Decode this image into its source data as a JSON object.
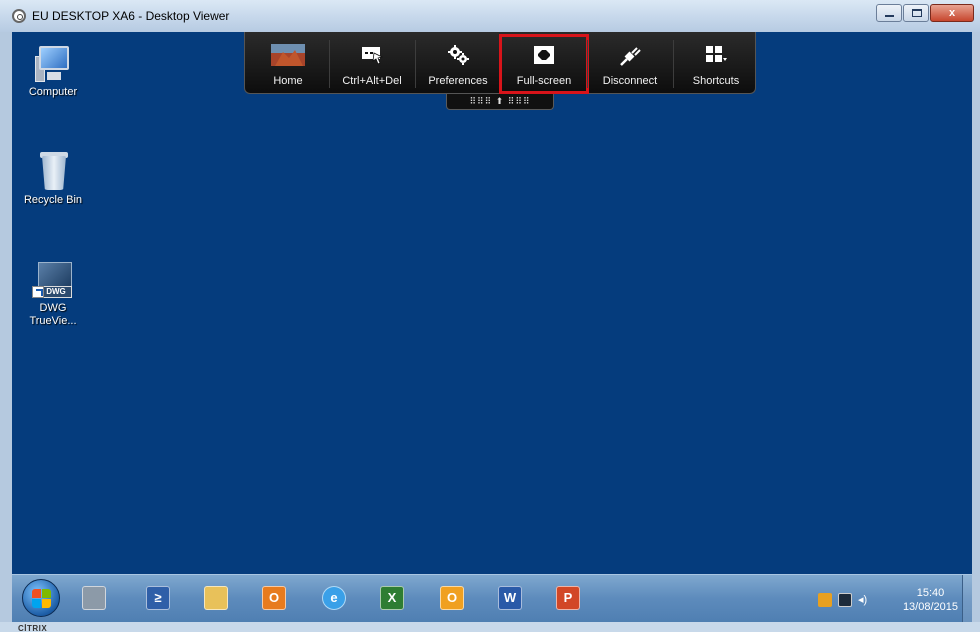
{
  "window": {
    "title": "EU DESKTOP XA6 - Desktop Viewer",
    "buttons": {
      "minimize": "",
      "maximize": "",
      "close": "x"
    }
  },
  "desktop": {
    "background_color": "#053c7d",
    "icons": [
      {
        "label": "Computer",
        "icon": "computer-icon"
      },
      {
        "label": "Recycle Bin",
        "icon": "recycle-bin-icon"
      },
      {
        "label": "DWG TrueVie...",
        "icon": "dwg-trueview-icon",
        "badge": "DWG"
      }
    ]
  },
  "toolbar": {
    "items": [
      {
        "label": "Home",
        "icon": "home-icon"
      },
      {
        "label": "Ctrl+Alt+Del",
        "icon": "ctrl-alt-del-icon"
      },
      {
        "label": "Preferences",
        "icon": "gears-icon"
      },
      {
        "label": "Full-screen",
        "icon": "fullscreen-icon",
        "highlighted": true
      },
      {
        "label": "Disconnect",
        "icon": "plug-icon"
      },
      {
        "label": "Shortcuts",
        "icon": "shortcuts-grid-icon"
      }
    ],
    "highlight_color": "#d8141a",
    "handle_text": "⠿⠿⠿ ⬆ ⠿⠿⠿"
  },
  "taskbar": {
    "apps": [
      {
        "name": "network-app-icon",
        "color": "#8c9aa8"
      },
      {
        "name": "powershell-icon",
        "color": "#2f5fa8",
        "glyph": "≥"
      },
      {
        "name": "file-explorer-icon",
        "color": "#e8c15a"
      },
      {
        "name": "outlook-icon",
        "color": "#e77b1e",
        "glyph": "O"
      },
      {
        "name": "internet-explorer-icon",
        "color": "#3aa0e8",
        "glyph": "e"
      },
      {
        "name": "excel-icon",
        "color": "#2e7d32",
        "glyph": "X"
      },
      {
        "name": "onenote-outlook-icon",
        "color": "#f0a020",
        "glyph": "O"
      },
      {
        "name": "word-icon",
        "color": "#2a5aa8",
        "glyph": "W"
      },
      {
        "name": "powerpoint-icon",
        "color": "#d24726",
        "glyph": "P"
      }
    ],
    "tray": {
      "icons": [
        "flash-icon",
        "network-tray-icon",
        "volume-icon"
      ],
      "time": "15:40",
      "date": "13/08/2015"
    }
  },
  "footer": {
    "brand": "CİTRIX"
  }
}
